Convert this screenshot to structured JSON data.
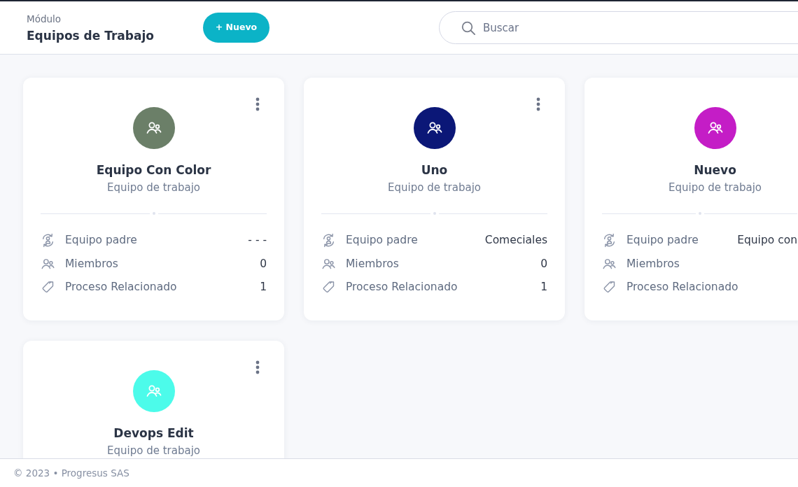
{
  "header": {
    "module_label": "Módulo",
    "title": "Equipos de Trabajo",
    "new_button": "+ Nuevo",
    "search": {
      "placeholder": "Buscar"
    }
  },
  "cards": [
    {
      "name": "Equipo Con Color",
      "subtitle": "Equipo de trabajo",
      "color": "#6b7f68",
      "rows": [
        {
          "kind": "parent",
          "label": "Equipo padre",
          "value": "- - -"
        },
        {
          "kind": "members",
          "label": "Miembros",
          "value": "0"
        },
        {
          "kind": "process",
          "label": "Proceso Relacionado",
          "value": "1"
        }
      ]
    },
    {
      "name": "Uno",
      "subtitle": "Equipo de trabajo",
      "color": "#0b1777",
      "rows": [
        {
          "kind": "parent",
          "label": "Equipo padre",
          "value": "Comeciales"
        },
        {
          "kind": "members",
          "label": "Miembros",
          "value": "0"
        },
        {
          "kind": "process",
          "label": "Proceso Relacionado",
          "value": "1"
        }
      ]
    },
    {
      "name": "Nuevo",
      "subtitle": "Equipo de trabajo",
      "color": "#c41dc6",
      "rows": [
        {
          "kind": "parent",
          "label": "Equipo padre",
          "value": "Equipo con"
        },
        {
          "kind": "members",
          "label": "Miembros"
        },
        {
          "kind": "process",
          "label": "Proceso Relacionado"
        }
      ]
    },
    {
      "name": "Devops Edit",
      "subtitle": "Equipo de trabajo",
      "color": "#4cfbea"
    }
  ],
  "footer": {
    "copyright": "© 2023 • Progresus SAS"
  }
}
